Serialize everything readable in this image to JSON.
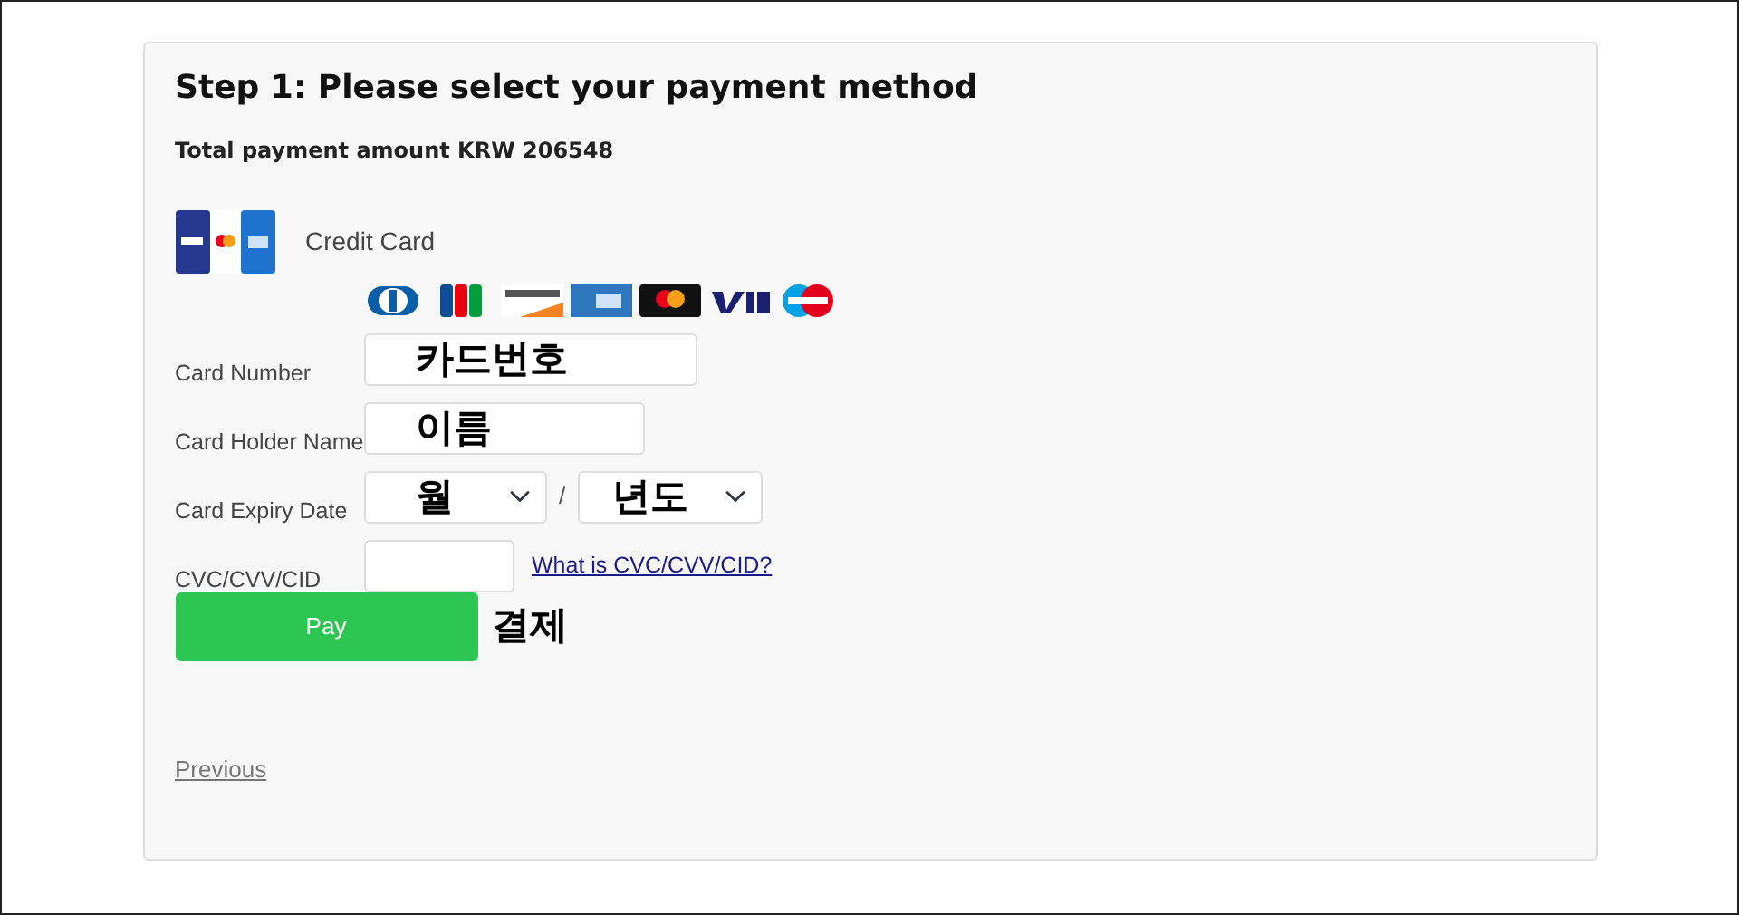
{
  "heading": "Step 1: Please select your payment method",
  "total": "Total payment amount KRW 206548",
  "method": {
    "label": "Credit Card"
  },
  "fields": [
    {
      "kind": "text",
      "label": "Card Number",
      "value": "카드번호"
    },
    {
      "kind": "text",
      "label": "Card Holder Name",
      "value": "이름"
    },
    {
      "kind": "expiry",
      "label": "Card Expiry Date",
      "month": "월",
      "separator": "/",
      "year": "년도"
    },
    {
      "kind": "cvc",
      "label": "CVC/CVV/CID",
      "help_link": "What is CVC/CVV/CID?"
    }
  ],
  "pay_button": "Pay",
  "pay_note": "결제",
  "previous_link": "Previous"
}
